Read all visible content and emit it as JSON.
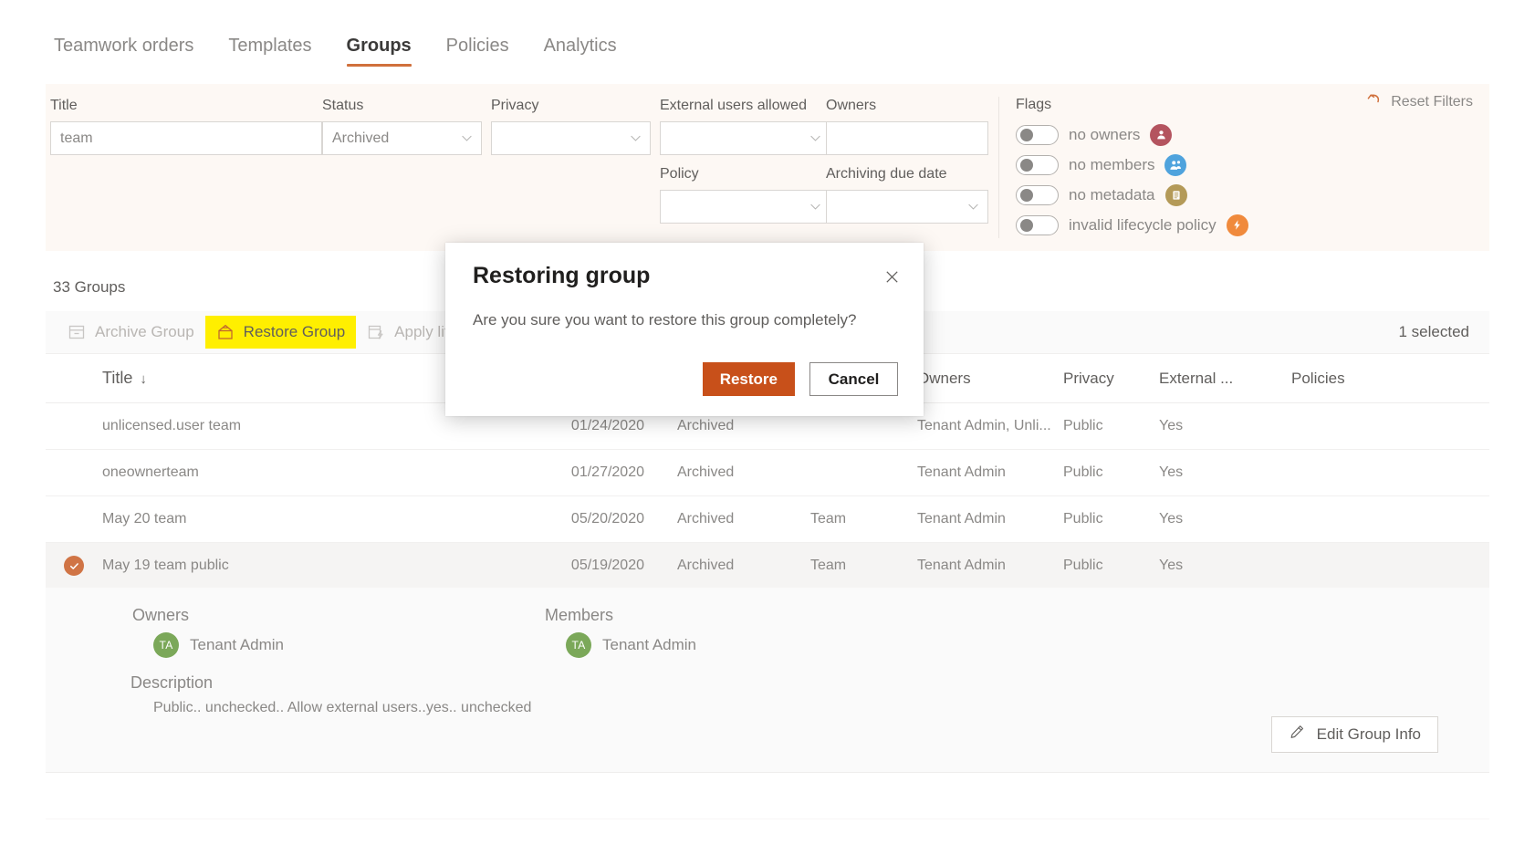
{
  "nav": {
    "tabs": [
      {
        "label": "Teamwork orders",
        "active": false
      },
      {
        "label": "Templates",
        "active": false
      },
      {
        "label": "Groups",
        "active": true
      },
      {
        "label": "Policies",
        "active": false
      },
      {
        "label": "Analytics",
        "active": false
      }
    ]
  },
  "filters": {
    "title": {
      "label": "Title",
      "value": "team"
    },
    "status": {
      "label": "Status",
      "value": "Archived"
    },
    "privacy": {
      "label": "Privacy",
      "value": ""
    },
    "external_users_allowed": {
      "label": "External users allowed",
      "value": ""
    },
    "owners": {
      "label": "Owners",
      "value": ""
    },
    "policy": {
      "label": "Policy",
      "value": ""
    },
    "archiving_due_date": {
      "label": "Archiving due date",
      "value": ""
    },
    "flags_title": "Flags",
    "flags": [
      {
        "label": "no owners",
        "on": false,
        "icon": "person-icon",
        "glyph": "♟",
        "color": "#b4545f"
      },
      {
        "label": "no members",
        "on": false,
        "icon": "people-icon",
        "glyph": "♟",
        "color": "#4fa3dd"
      },
      {
        "label": "no metadata",
        "on": false,
        "icon": "document-icon",
        "glyph": "☰",
        "color": "#b49a58"
      },
      {
        "label": "invalid lifecycle policy",
        "on": false,
        "icon": "lightning-icon",
        "glyph": "⚡",
        "color": "#f08a3c"
      }
    ],
    "reset_label": "Reset Filters",
    "reset_icon": "undo-arrow-icon",
    "accent": "#d0703c"
  },
  "list": {
    "count_label": "33 Groups",
    "selected_label": "1 selected",
    "commands": [
      {
        "label": "Archive Group",
        "icon": "archive-box-icon",
        "highlighted": false,
        "disabled": true
      },
      {
        "label": "Restore Group",
        "icon": "restore-box-icon",
        "highlighted": true,
        "disabled": false
      },
      {
        "label": "Apply lifec",
        "icon": "lifecycle-icon",
        "highlighted": false,
        "disabled": true
      }
    ],
    "columns": [
      "Title",
      "",
      "",
      "",
      "Owners",
      "Privacy",
      "External ...",
      "Policies"
    ],
    "sort_column": "Title",
    "sort_direction": "desc",
    "sort_glyph": "↓",
    "rows": [
      {
        "title": "unlicensed.user team",
        "date": "01/24/2020",
        "status": "Archived",
        "type": "",
        "owners": "Tenant Admin, Unli...",
        "privacy": "Public",
        "external": "Yes",
        "policies": "",
        "selected": false
      },
      {
        "title": "oneownerteam",
        "date": "01/27/2020",
        "status": "Archived",
        "type": "",
        "owners": "Tenant Admin",
        "privacy": "Public",
        "external": "Yes",
        "policies": "",
        "selected": false
      },
      {
        "title": "May 20 team",
        "date": "05/20/2020",
        "status": "Archived",
        "type": "Team",
        "owners": "Tenant Admin",
        "privacy": "Public",
        "external": "Yes",
        "policies": "",
        "selected": false
      },
      {
        "title": "May 19 team public",
        "date": "05/19/2020",
        "status": "Archived",
        "type": "Team",
        "owners": "Tenant Admin",
        "privacy": "Public",
        "external": "Yes",
        "policies": "",
        "selected": true
      }
    ],
    "partial_row": {
      "date": "",
      "status": "",
      "owners": "",
      "privacy": "",
      "external": ""
    }
  },
  "detail": {
    "owners_header": "Owners",
    "owner_name": "Tenant Admin",
    "owner_initials": "TA",
    "members_header": "Members",
    "member_name": "Tenant Admin",
    "member_initials": "TA",
    "description_header": "Description",
    "description_text": "Public.. unchecked.. Allow external users..yes.. unchecked",
    "edit_button_label": "Edit Group Info",
    "edit_button_icon": "pencil-icon"
  },
  "modal": {
    "title": "Restoring group",
    "body": "Are you sure you want to restore this group completely?",
    "confirm_label": "Restore",
    "cancel_label": "Cancel",
    "close_icon": "close-icon",
    "confirm_color": "#c8501a"
  }
}
